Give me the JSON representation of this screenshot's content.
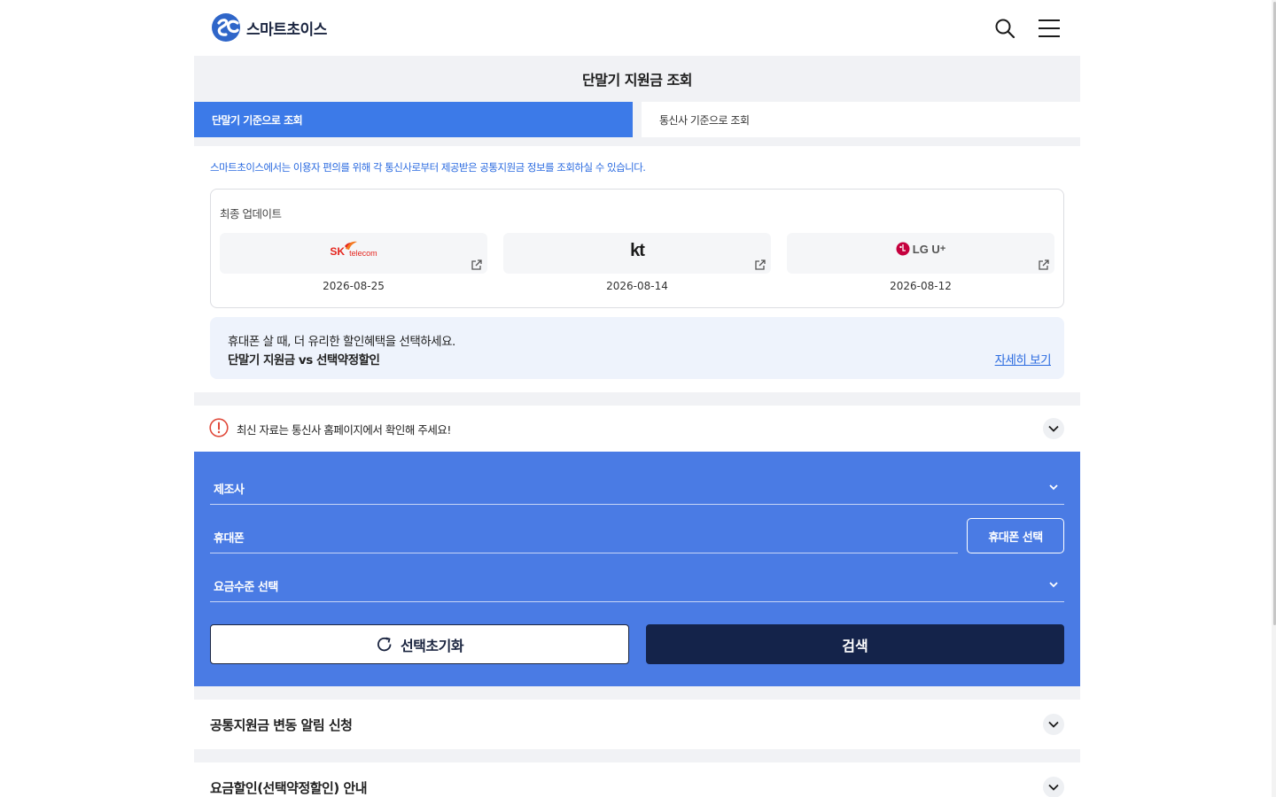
{
  "header": {
    "brand": "스마트초이스",
    "logo_icon": "smartchoice-logo-icon",
    "search_icon": "search-icon",
    "menu_icon": "hamburger-menu-icon"
  },
  "page": {
    "title": "단말기 지원금 조회"
  },
  "tabs": [
    {
      "label": "단말기 기준으로 조회",
      "active": true
    },
    {
      "label": "통신사 기준으로 조회",
      "active": false
    }
  ],
  "notice": "스마트초이스에서는 이용자 편의를 위해 각 통신사로부터 제공받은 공통지원금 정보를 조회하실 수 있습니다.",
  "updates": {
    "title": "최종 업데이트",
    "carriers": [
      {
        "logo_sk": "SK",
        "logo_telecom": "telecom",
        "date": "2026-08-25"
      },
      {
        "logo": "kt",
        "date": "2026-08-14"
      },
      {
        "logo": "LG U",
        "logo_sup": "+",
        "date": "2026-08-12"
      }
    ]
  },
  "promo": {
    "line1": "휴대폰 살 때, 더 유리한 할인혜택을 선택하세요.",
    "line2": "단말기 지원금 vs 선택약정할인",
    "link": "자세히 보기"
  },
  "warning": {
    "text": "최신 자료는 통신사 홈페이지에서 확인해 주세요!",
    "icon": "exclamation-circle-icon"
  },
  "search": {
    "manufacturer_label": "제조사",
    "phone_label": "휴대폰",
    "phone_button": "휴대폰 선택",
    "plan_label": "요금수준 선택",
    "reset_button": "선택초기화",
    "search_button": "검색"
  },
  "accordions": [
    {
      "title": "공통지원금 변동 알림 신청"
    },
    {
      "title": "요금할인(선택약정할인) 안내"
    }
  ],
  "colors": {
    "primary": "#3c7ae8",
    "panel": "#4a7be4",
    "navy": "#14234a",
    "link": "#2b6be0",
    "warning": "#e0493a"
  }
}
